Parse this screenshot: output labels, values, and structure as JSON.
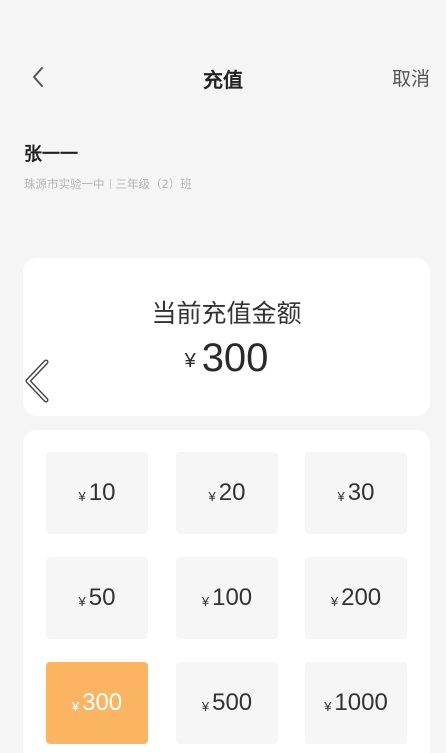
{
  "nav": {
    "back_icon": "chevron-left-icon",
    "title": "充值",
    "cancel_label": "取消"
  },
  "student": {
    "name": "张一一",
    "school": "珠源市实验一中",
    "class": "三年级（2）班"
  },
  "amount_card": {
    "label": "当前充值金额",
    "currency": "¥",
    "value": "300"
  },
  "options": [
    {
      "currency": "¥",
      "value": "10",
      "selected": false
    },
    {
      "currency": "¥",
      "value": "20",
      "selected": false
    },
    {
      "currency": "¥",
      "value": "30",
      "selected": false
    },
    {
      "currency": "¥",
      "value": "50",
      "selected": false
    },
    {
      "currency": "¥",
      "value": "100",
      "selected": false
    },
    {
      "currency": "¥",
      "value": "200",
      "selected": false
    },
    {
      "currency": "¥",
      "value": "300",
      "selected": true
    },
    {
      "currency": "¥",
      "value": "500",
      "selected": false
    },
    {
      "currency": "¥",
      "value": "1000",
      "selected": false
    }
  ],
  "colors": {
    "selected_tile": "#fbb462",
    "tile": "#f6f6f6",
    "background": "#f5f5f5"
  }
}
